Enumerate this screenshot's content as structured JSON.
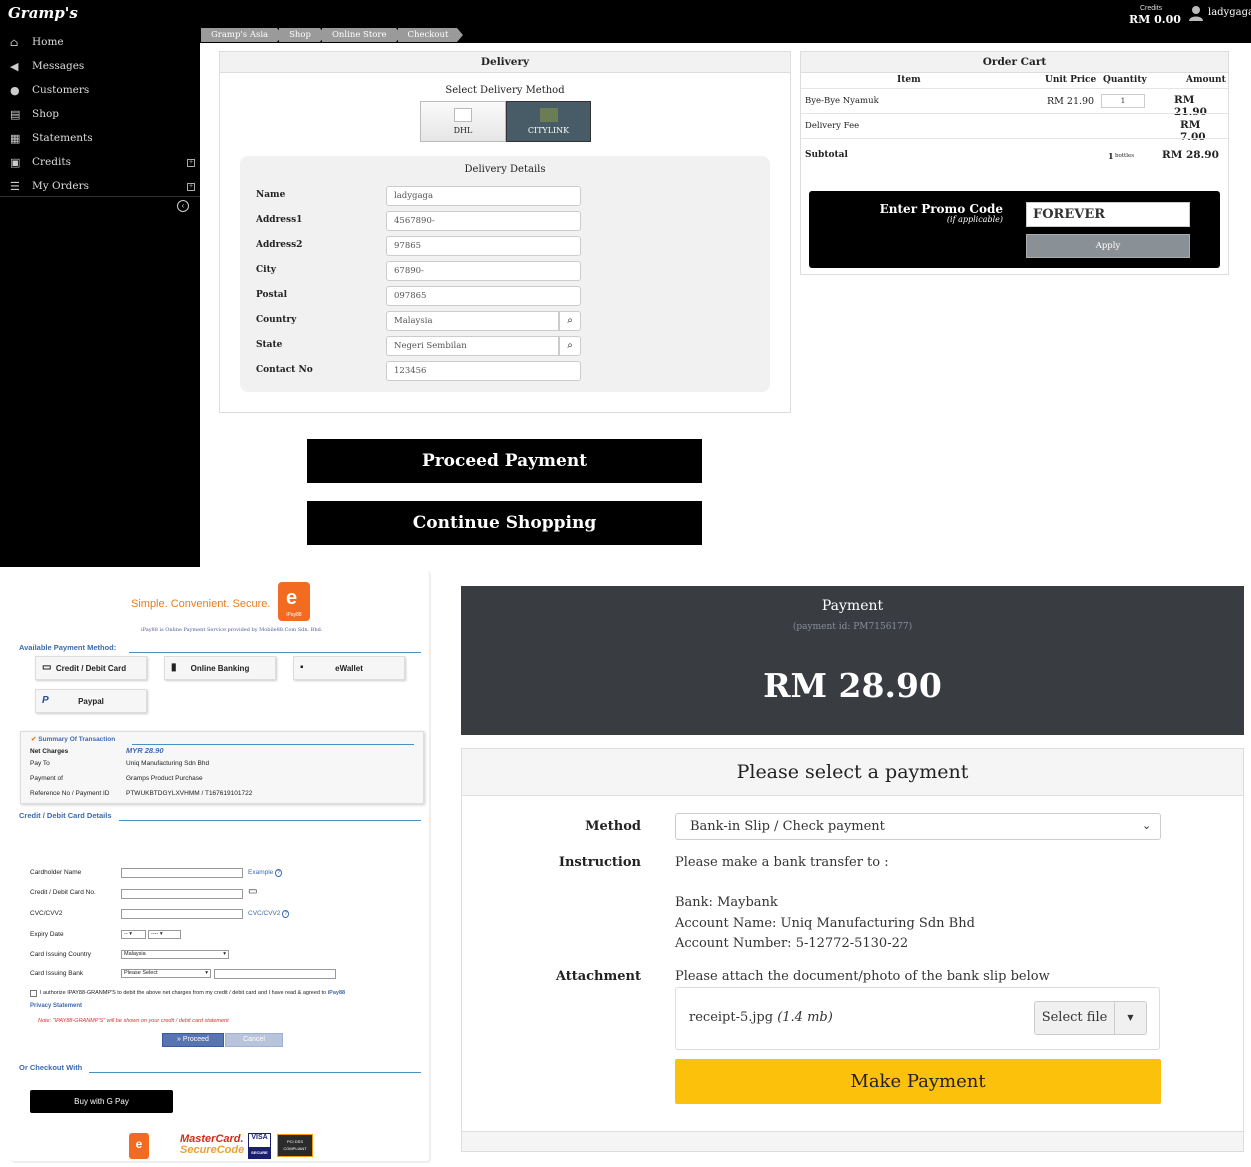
{
  "topbar": {
    "logo": "Gramp's",
    "credits_label": "Credits",
    "credits_value": "RM 0.00",
    "user_name": "ladygaga",
    "user_icon": "user-avatar-icon"
  },
  "sidebar": {
    "items": [
      {
        "label": "Home",
        "icon": "home-icon"
      },
      {
        "label": "Messages",
        "icon": "bullhorn-icon"
      },
      {
        "label": "Customers",
        "icon": "user-icon"
      },
      {
        "label": "Shop",
        "icon": "cart-icon"
      },
      {
        "label": "Statements",
        "icon": "print-icon"
      },
      {
        "label": "Credits",
        "icon": "money-icon"
      },
      {
        "label": "My Orders",
        "icon": "list-icon"
      }
    ]
  },
  "breadcrumb": [
    "Gramp's Asia",
    "Shop",
    "Online Store",
    "Checkout"
  ],
  "delivery": {
    "title": "Delivery",
    "select_method_label": "Select Delivery Method",
    "methods": [
      "DHL",
      "CITYLINK"
    ],
    "selected_method": "CITYLINK",
    "details_title": "Delivery Details",
    "fields": [
      {
        "label": "Name",
        "value": "ladygaga"
      },
      {
        "label": "Address1",
        "value": "4567890-"
      },
      {
        "label": "Address2",
        "value": "97865"
      },
      {
        "label": "City",
        "value": "67890-"
      },
      {
        "label": "Postal",
        "value": "097865"
      },
      {
        "label": "Country",
        "value": "Malaysia"
      },
      {
        "label": "State",
        "value": "Negeri Sembilan"
      },
      {
        "label": "Contact No",
        "value": "123456"
      }
    ]
  },
  "cart": {
    "title": "Order Cart",
    "columns": [
      "Item",
      "Unit Price",
      "Quantity",
      "Amount"
    ],
    "rows": [
      {
        "item": "Bye-Bye Nyamuk",
        "unit_price": "RM 21.90",
        "quantity": "1",
        "amount": "RM 21.90"
      }
    ],
    "delivery_fee_label": "Delivery Fee",
    "delivery_fee": "RM 7.00",
    "subtotal_label": "Subtotal",
    "subtotal_qty": "1",
    "subtotal_qty_unit": "bottles",
    "subtotal": "RM 28.90",
    "promo_label": "Enter Promo Code",
    "promo_sub": "(if applicable)",
    "promo_value": "FOREVER",
    "apply_label": "Apply"
  },
  "actions": {
    "proceed_payment": "Proceed Payment",
    "continue_shopping": "Continue Shopping"
  },
  "ipay": {
    "slogan": "Simple. Convenient. Secure.",
    "logo_text": "iPay88",
    "sub": "iPay88 is Online Payment Service provided by Mobile88.Com Sdn. Bhd.",
    "available_title": "Available Payment Method:",
    "methods": [
      "Credit / Debit Card",
      "Online Banking",
      "eWallet",
      "Paypal"
    ],
    "summary_title": "Summary Of Transaction",
    "summary": [
      {
        "label": "Net Charges",
        "value": "MYR 28.90"
      },
      {
        "label": "Pay To",
        "value": "Uniq Manufacturing Sdn Bhd"
      },
      {
        "label": "Payment of",
        "value": "Gramps Product Purchase"
      },
      {
        "label": "Reference No / Payment ID",
        "value": "PTWUKBTDGYLXVHMM / T167619101722"
      }
    ],
    "card_title": "Credit / Debit Card Details",
    "card_fields": {
      "holder": "Cardholder Name",
      "number": "Credit / Debit Card No.",
      "cvc": "CVC/CVV2",
      "expiry": "Expiry Date",
      "country": "Card Issuing Country",
      "bank": "Card Issuing Bank"
    },
    "example_link": "Example",
    "cvc_link": "CVC/CVV2",
    "expiry_month": "--",
    "expiry_year": "----",
    "country_value": "Malaysia",
    "bank_value": "Please Select",
    "authorize_text": "I authorize IPAY88-GRANMP'S to debit the above net charges from my credit / debit card and I have read & agreed to",
    "authorize_link": "iPay88",
    "privacy_link": "Privacy Statement",
    "note": "Note: \"IPAY88-GRANMP'S\" will be shown on your credit / debit card statement",
    "proceed_label": "» Proceed",
    "cancel_label": "Cancel",
    "or_checkout": "Or Checkout With",
    "gpay_label": "Buy with G Pay",
    "footer": {
      "mc1": "MasterCard.",
      "mc2": "SecureCode",
      "visa": "VISA",
      "visa_sub": "SECURE",
      "pci": "PCI DSS COMPLIANT",
      "ipay_glyph": "e"
    }
  },
  "payment": {
    "title": "Payment",
    "payment_id": "(payment id: PM7156177)",
    "amount": "RM 28.90",
    "select_title": "Please select a payment",
    "method_label": "Method",
    "method_value": "Bank-in Slip / Check payment",
    "instruction_label": "Instruction",
    "instruction_intro": "Please make a bank transfer to :",
    "bank": "Bank: Maybank",
    "account_name": "Account Name: Uniq Manufacturing Sdn Bhd",
    "account_number": "Account Number: 5-12772-5130-22",
    "attachment_label": "Attachment",
    "attachment_hint": "Please attach the document/photo of the bank slip below",
    "file_name": "receipt-5.jpg",
    "file_size": "(1.4 mb)",
    "select_file": "Select file",
    "make_payment": "Make Payment"
  }
}
